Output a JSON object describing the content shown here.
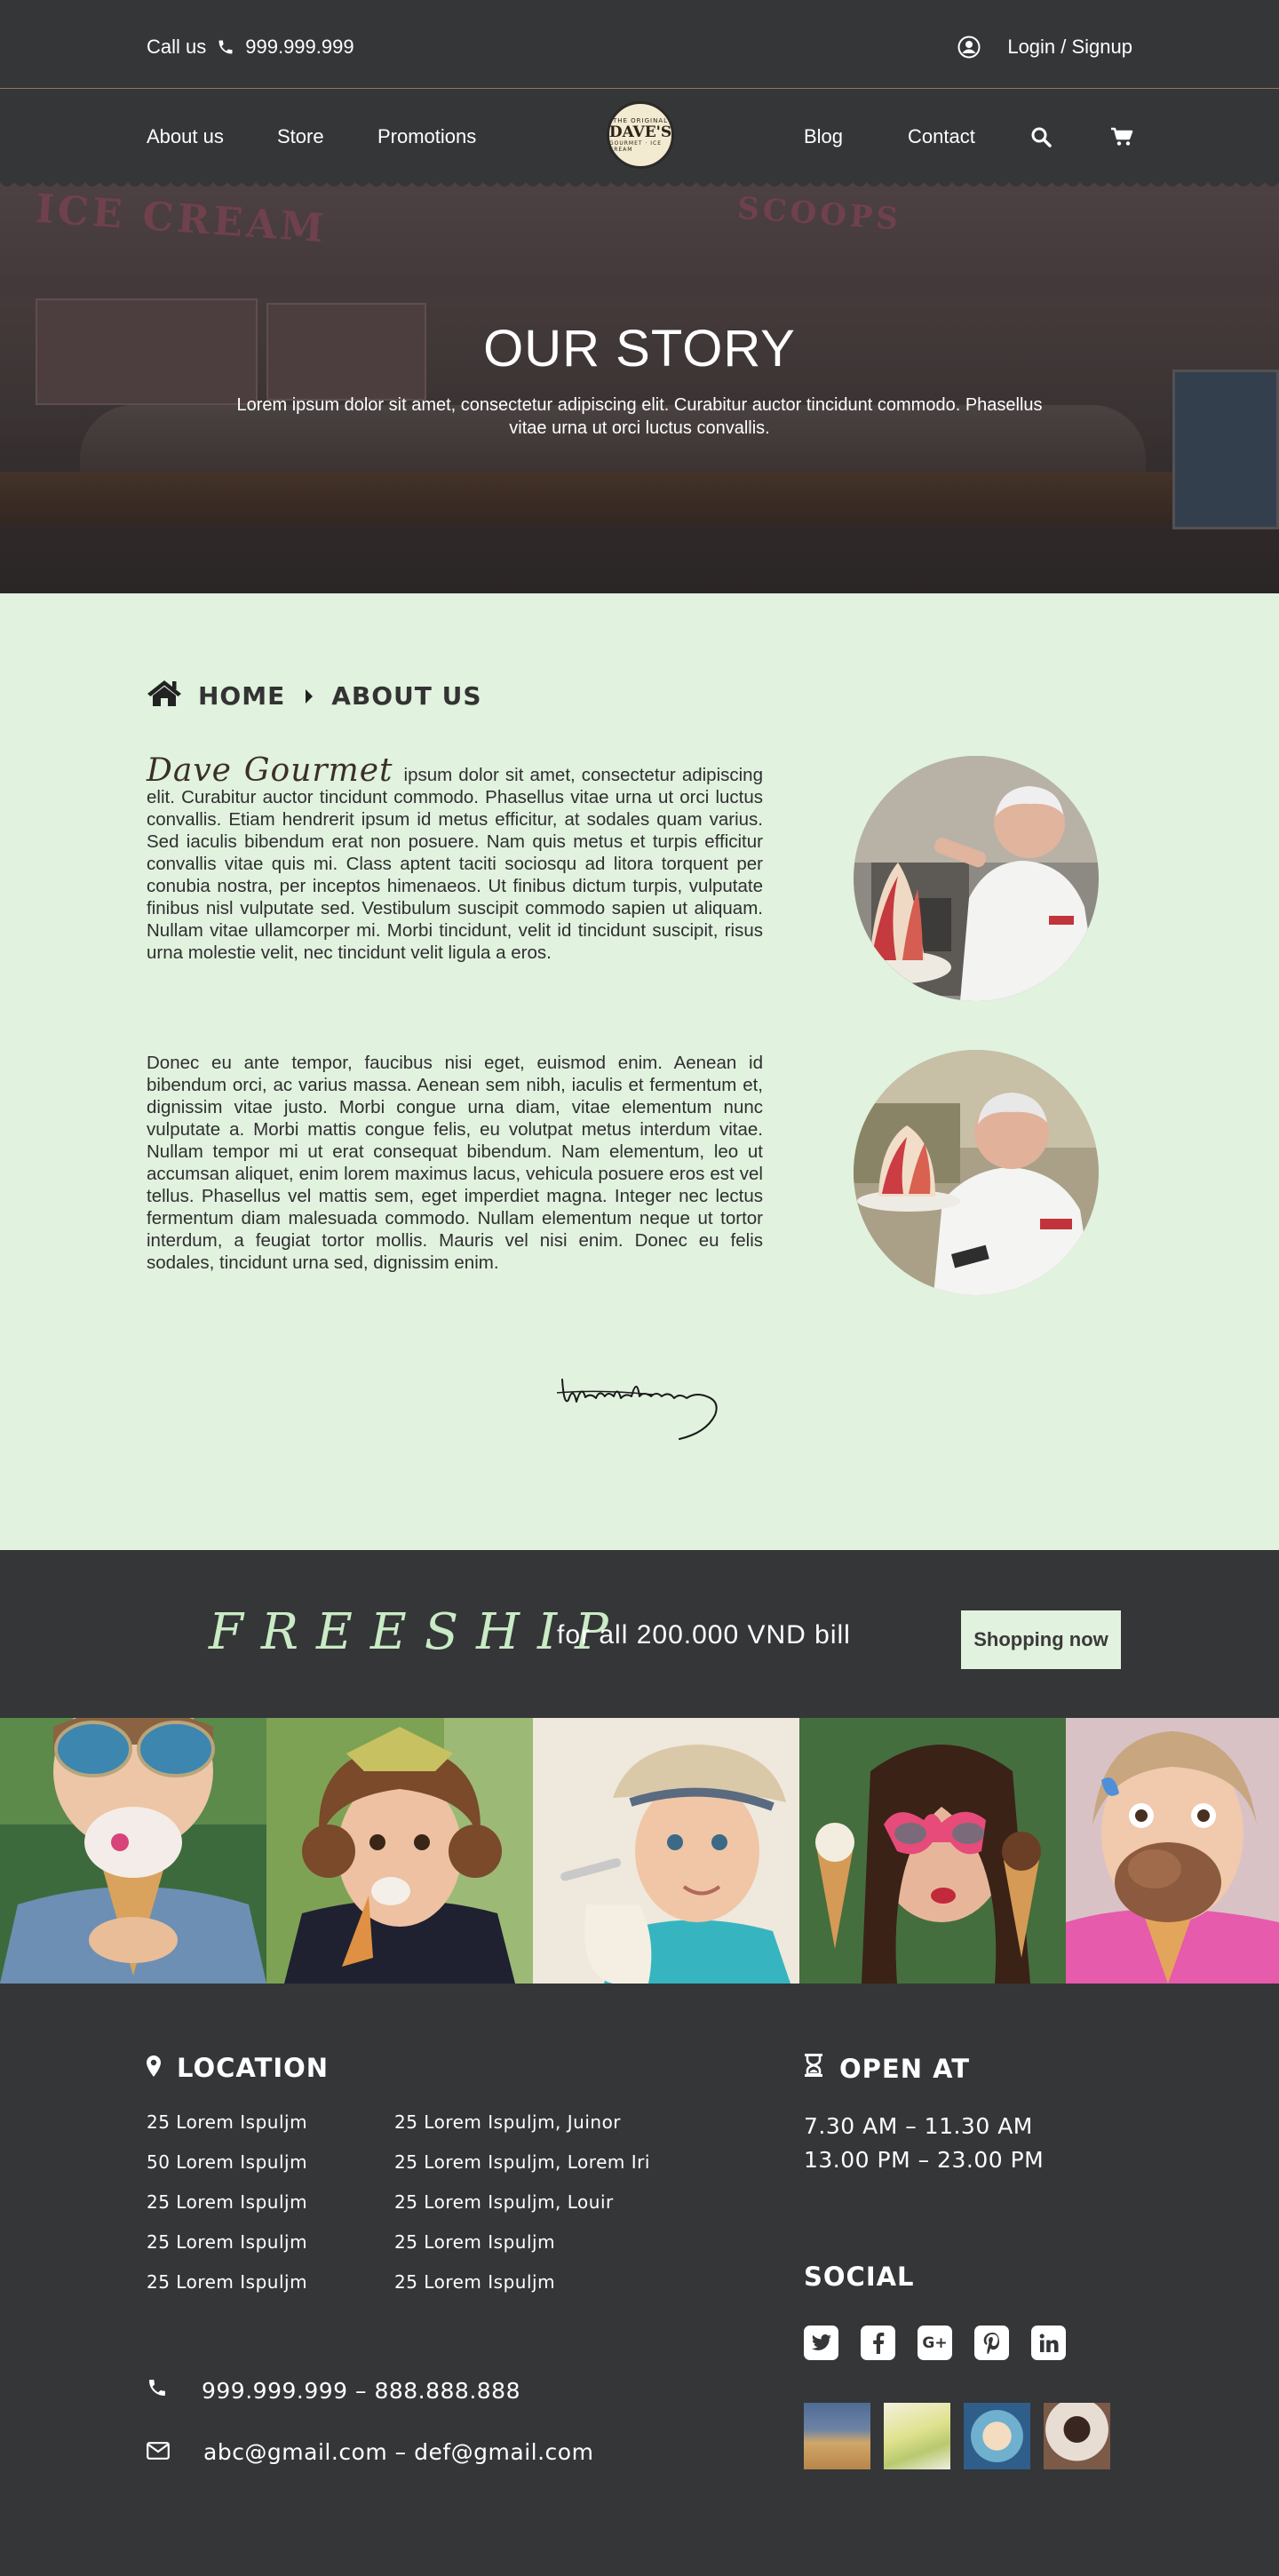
{
  "topbar": {
    "call_label": "Call us",
    "phone": "999.999.999",
    "login_label": "Login / Signup"
  },
  "nav": {
    "left": [
      "About us",
      "Store",
      "Promotions"
    ],
    "right": [
      "Blog",
      "Contact"
    ],
    "logo": {
      "top": "THE ORIGINAL",
      "name": "DAVE'S",
      "bottom": "GOURMET · ICE CREAM"
    }
  },
  "hero": {
    "title": "OUR STORY",
    "subtitle": "Lorem ipsum dolor sit amet, consectetur adipiscing elit. Curabitur auctor tincidunt commodo. Phasellus vitae urna ut orci luctus convallis."
  },
  "breadcrumb": {
    "home": "HOME",
    "current": "ABOUT US"
  },
  "story": {
    "lead": "Dave Gourmet",
    "paragraph1": "ipsum dolor sit amet, consectetur adipiscing elit. Curabitur auctor tincidunt commodo. Phasellus vitae urna ut orci luctus convallis. Etiam hendrerit ipsum id metus efficitur, at sodales quam varius. Sed iaculis bibendum erat non posuere. Nam quis metus et turpis efficitur convallis vitae quis mi. Class aptent taciti sociosqu ad litora torquent per conubia nostra, per inceptos himenaeos. Ut finibus dictum turpis, vulputate finibus nisl vulputate sed. Vestibulum suscipit commodo sapien ut aliquam. Nullam vitae ullamcorper mi. Morbi tincidunt, velit id tincidunt suscipit, risus urna molestie velit, nec tincidunt velit ligula a eros.",
    "paragraph2": "Donec eu ante tempor, faucibus nisi eget, euismod enim. Aenean id bibendum orci, ac varius massa. Aenean sem nibh, iaculis et fermentum et, dignissim vitae justo. Morbi congue urna diam, vitae elementum nunc vulputate a. Morbi mattis congue felis, eu volutpat metus interdum vitae. Nullam tempor mi ut erat consequat bibendum. Nam elementum, leo ut accumsan aliquet, enim lorem maximus lacus, vehicula posuere eros est vel tellus. Phasellus vel mattis sem, eget imperdiet magna. Integer nec lectus fermentum diam malesuada commodo. Nullam elementum neque ut tortor interdum, a feugiat tortor mollis. Mauris vel nisi enim. Donec eu felis sodales, tincidunt urna sed, dignissim enim.",
    "signature": "Woodrow Wilson"
  },
  "promo": {
    "headline": "FREESHIP",
    "text": "for all 200.000 VND bill",
    "button": "Shopping now"
  },
  "footer": {
    "location_title": "LOCATION",
    "addresses_col1": [
      "25 Lorem Ispuljm",
      "50 Lorem Ispuljm",
      "25 Lorem Ispuljm",
      "25 Lorem Ispuljm",
      "25 Lorem Ispuljm"
    ],
    "addresses_col2": [
      "25 Lorem Ispuljm, Juinor",
      "25 Lorem Ispuljm, Lorem Iri",
      "25 Lorem Ispuljm, Louir",
      "25 Lorem Ispuljm",
      "25 Lorem Ispuljm"
    ],
    "open_title": "OPEN AT",
    "hours": [
      "7.30 AM  – 11.30 AM",
      "13.00 PM  – 23.00 PM"
    ],
    "social_title": "SOCIAL",
    "social_icons": [
      "twitter-icon",
      "facebook-icon",
      "google-plus-icon",
      "pinterest-icon",
      "linkedin-icon"
    ],
    "phone": "999.999.999 – 888.888.888",
    "email": "abc@gmail.com – def@gmail.com"
  },
  "colors": {
    "dark": "#353638",
    "mint": "#e1f2df",
    "freeship": "#c9ebc5",
    "divider": "#8a7a5a"
  }
}
